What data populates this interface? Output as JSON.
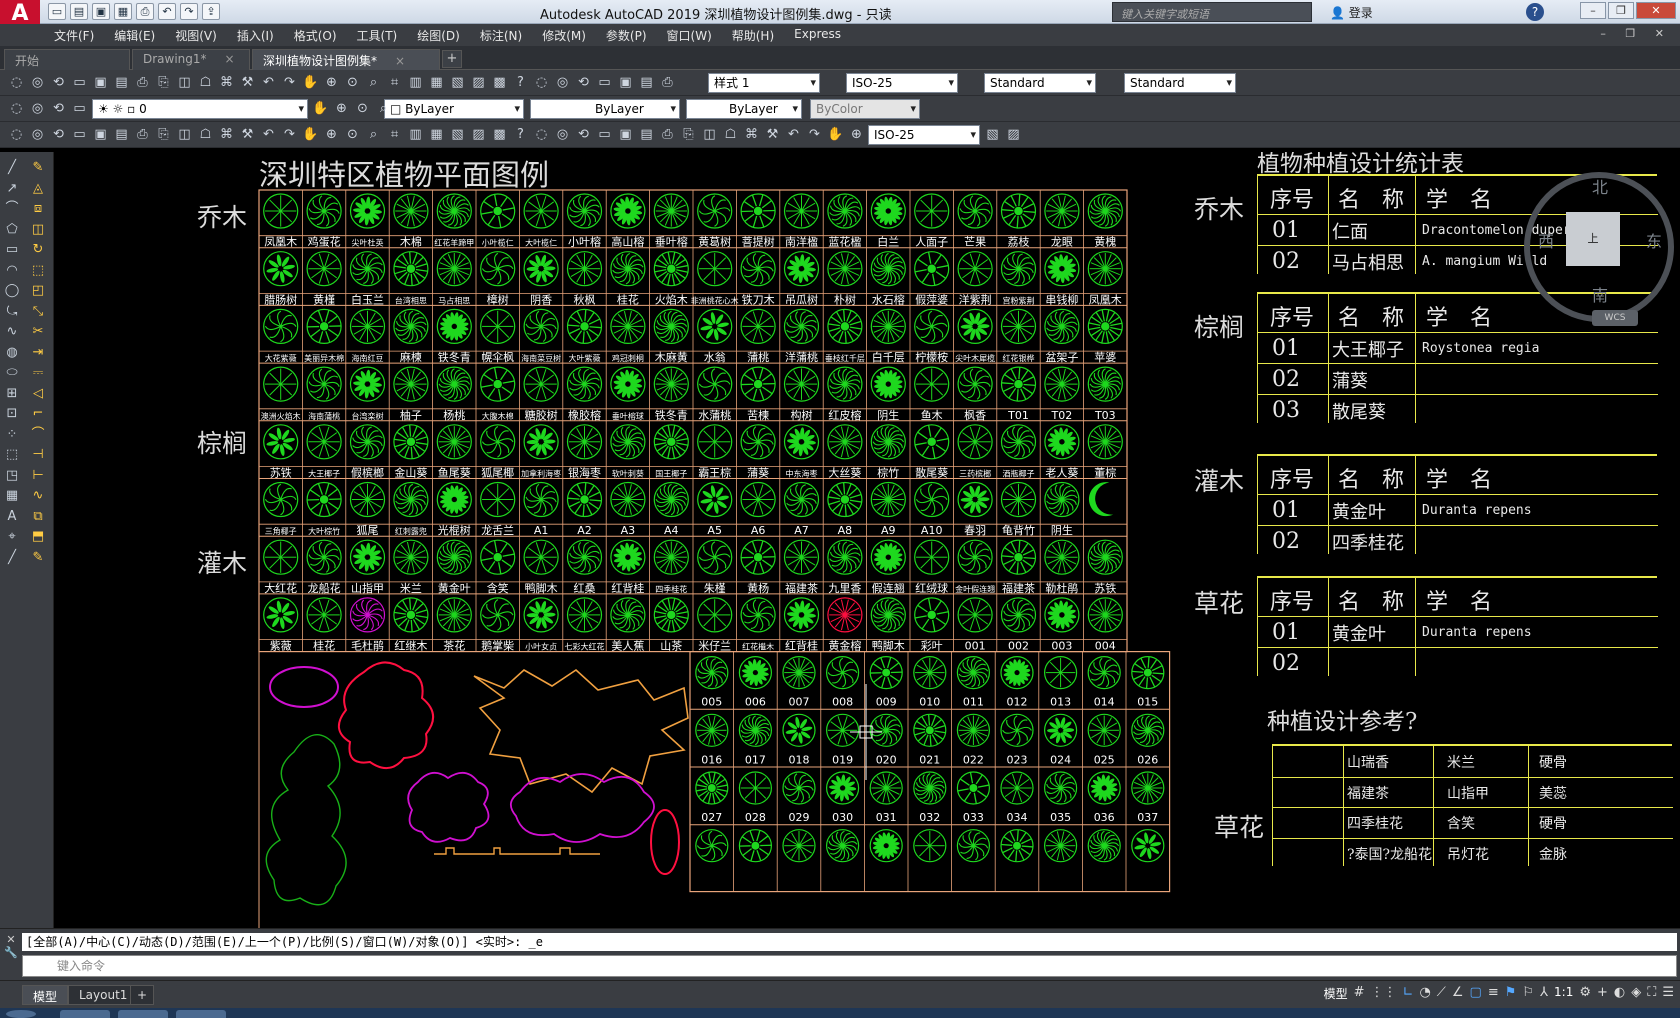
{
  "app": {
    "logo": "A",
    "title": "Autodesk AutoCAD 2019    深圳植物设计图例集.dwg - 只读",
    "search_placeholder": "键入关键字或短语",
    "login": "登录",
    "help": "?"
  },
  "menu": [
    "文件(F)",
    "编辑(E)",
    "视图(V)",
    "插入(I)",
    "格式(O)",
    "工具(T)",
    "绘图(D)",
    "标注(N)",
    "修改(M)",
    "参数(P)",
    "窗口(W)",
    "帮助(H)",
    "Express"
  ],
  "tabs": [
    {
      "label": "开始"
    },
    {
      "label": "Drawing1*"
    },
    {
      "label": "深圳植物设计图例集*"
    }
  ],
  "toolbar": {
    "text_style": "样式 1",
    "dim_style": "ISO-25",
    "table_style": "Standard",
    "mleader_style": "Standard",
    "layer": "0",
    "color": "ByLayer",
    "linetype": "ByLayer",
    "lineweight": "ByLayer",
    "plotstyle": "ByColor",
    "dim_style2": "ISO-25"
  },
  "drawing": {
    "legend_title": "深圳特区植物平面图例",
    "categories": [
      "乔木",
      "棕榈",
      "灌木",
      "草花"
    ],
    "row_labels": [
      [
        "凤凰木",
        "鸡蛋花",
        "尖叶杜英",
        "木棉",
        "红花羊蹄甲",
        "小叶榄仁",
        "大叶榄仁",
        "小叶榕",
        "高山榕",
        "垂叶榕",
        "黄葛树",
        "菩提树",
        "南洋楹",
        "蓝花楹",
        "白兰",
        "人面子",
        "芒果",
        "荔枝",
        "龙眼",
        "黄槐"
      ],
      [
        "腊肠树",
        "黄槿",
        "白玉兰",
        "台湾相思",
        "马占相思",
        "樟树",
        "阴香",
        "秋枫",
        "桂花",
        "火焰木",
        "非洲桃花心木",
        "铁刀木",
        "吊瓜树",
        "朴树",
        "水石榕",
        "假萍婆",
        "洋紫荆",
        "宫粉紫荆",
        "串钱柳",
        "凤凰木"
      ],
      [
        "大花紫薇",
        "美丽异木棉",
        "海南红豆",
        "麻楝",
        "铁冬青",
        "幌伞枫",
        "海南菜豆树",
        "大叶紫薇",
        "鸡冠刺桐",
        "木麻黄",
        "水翁",
        "蒲桃",
        "洋蒲桃",
        "垂枝红千层",
        "白千层",
        "柠檬桉",
        "尖叶木犀榄",
        "红花银桦",
        "盆架子",
        "苹婆"
      ],
      [
        "澳洲火焰木",
        "海南蒲桃",
        "台湾栾树",
        "柚子",
        "杨桃",
        "大腹木棉",
        "糖胶树",
        "橡胶榕",
        "垂叶榕球",
        "铁冬青",
        "水蒲桃",
        "苦楝",
        "构树",
        "红皮榕",
        "阴生",
        "鱼木",
        "枫香",
        "T01",
        "T02",
        "T03"
      ],
      [
        "苏铁",
        "大王椰子",
        "假槟榔",
        "金山葵",
        "鱼尾葵",
        "狐尾椰",
        "加拿利海枣",
        "银海枣",
        "软叶刺葵",
        "国王椰子",
        "霸王棕",
        "蒲葵",
        "中东海枣",
        "大丝葵",
        "棕竹",
        "散尾葵",
        "三药槟榔",
        "酒瓶椰子",
        "老人葵",
        "董棕"
      ],
      [
        "三角椰子",
        "大叶棕竹",
        "狐尾",
        "红刺露兜",
        "光棍树",
        "龙舌兰",
        "A1",
        "A2",
        "A3",
        "A4",
        "A5",
        "A6",
        "A7",
        "A8",
        "A9",
        "A10",
        "春羽",
        "龟背竹",
        "阴生"
      ],
      [
        "大红花",
        "龙船花",
        "山指甲",
        "米兰",
        "黄金叶",
        "含笑",
        "鸭脚木",
        "红桑",
        "红背桂",
        "四季桂花",
        "朱槿",
        "黄杨",
        "福建茶",
        "九里香",
        "假连翘",
        "红绒球",
        "金叶假连翘",
        "福建茶",
        "勒杜鹃",
        "苏铁"
      ],
      [
        "紫薇",
        "桂花",
        "毛杜鹃",
        "红继木",
        "茶花",
        "鹅掌柴",
        "小叶女贞",
        "七彩大红花",
        "美人蕉",
        "山茶",
        "米仔兰",
        "红花檵木",
        "红背桂",
        "黄金榕",
        "鸭脚木",
        "彩叶",
        "001",
        "002",
        "003",
        "004"
      ]
    ],
    "num_labels": [
      [
        "005",
        "006",
        "007",
        "008",
        "009",
        "010",
        "011",
        "012",
        "013",
        "014",
        "015"
      ],
      [
        "016",
        "017",
        "018",
        "019",
        "020",
        "021",
        "022",
        "023",
        "024",
        "025",
        "026"
      ],
      [
        "027",
        "028",
        "029",
        "030",
        "031",
        "032",
        "033",
        "034",
        "035",
        "036",
        "037"
      ]
    ],
    "stats_title": "植物种植设计统计表",
    "col_headers": [
      "序号",
      "名　称",
      "学　名"
    ],
    "groups": [
      {
        "rows": [
          {
            "no": "01",
            "name": "仁面",
            "latin": "Dracontomelon duperreanum"
          },
          {
            "no": "02",
            "name": "马占相思",
            "latin": "A. mangium Willd"
          }
        ]
      },
      {
        "rows": [
          {
            "no": "01",
            "name": "大王椰子",
            "latin": "Roystonea regia"
          },
          {
            "no": "02",
            "name": "蒲葵",
            "latin": ""
          },
          {
            "no": "03",
            "name": "散尾葵",
            "latin": ""
          }
        ]
      },
      {
        "rows": [
          {
            "no": "01",
            "name": "黄金叶",
            "latin": "Duranta repens"
          },
          {
            "no": "02",
            "name": "四季桂花",
            "latin": ""
          }
        ]
      },
      {
        "rows": [
          {
            "no": "01",
            "name": "黄金叶",
            "latin": "Duranta repens"
          },
          {
            "no": "02",
            "name": "",
            "latin": ""
          }
        ]
      }
    ],
    "ref_title": "种植设计参考?",
    "ref_table": [
      [
        "山瑞香",
        "米兰",
        "硬骨"
      ],
      [
        "福建茶",
        "山指甲",
        "美蕊"
      ],
      [
        "四季桂花",
        "含笑",
        "硬骨"
      ],
      [
        "?泰国?龙船花",
        "吊灯花",
        "金脉"
      ]
    ],
    "nav": {
      "n": "北",
      "s": "南",
      "w": "西",
      "e": "东",
      "center": "上",
      "wcs": "WCS"
    }
  },
  "command": {
    "history": "[全部(A)/中心(C)/动态(D)/范围(E)/上一个(P)/比例(S)/窗口(W)/对象(O)] <实时>: _e",
    "placeholder": "键入命令"
  },
  "status": {
    "model_tab": "模型",
    "layout_tab": "Layout1",
    "mode": "模型",
    "scale": "1:1"
  },
  "colors": {
    "plant": "#1ed81e",
    "grid": "#e8a47a",
    "magenta": "#d010d0",
    "red": "#ff1040",
    "orange": "#f0a040",
    "green_outline": "#18b018",
    "yellow": "#e8e84a"
  }
}
